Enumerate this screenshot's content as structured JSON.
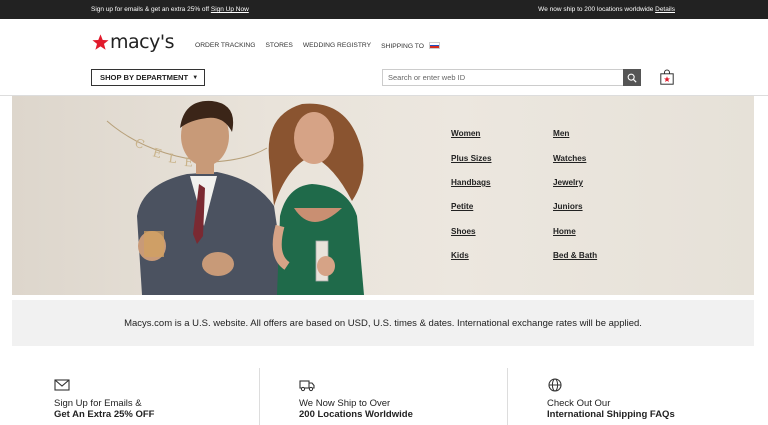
{
  "promo_bar": {
    "left_text": "Sign up for emails & get an extra 25% off",
    "left_link": "Sign Up Now",
    "right_text": "We now ship to 200 locations worldwide",
    "right_link": "Details"
  },
  "header": {
    "logo_text": "macy's",
    "nav": [
      "ORDER TRACKING",
      "STORES",
      "WEDDING REGISTRY",
      "SHIPPING TO"
    ],
    "flag_colors": [
      "#ffffff",
      "#1f4fc1",
      "#d52b1e"
    ],
    "department_button": "SHOP BY DEPARTMENT",
    "search_placeholder": "Search or enter web ID",
    "brand_color": "#e21a2c"
  },
  "hero": {
    "departments_left": [
      "Women",
      "Plus Sizes",
      "Handbags",
      "Petite",
      "Shoes",
      "Kids"
    ],
    "departments_right": [
      "Men",
      "Watches",
      "Jewelry",
      "Juniors",
      "Home",
      "Bed & Bath"
    ]
  },
  "notice": "Macys.com is a U.S. website. All offers are based on USD, U.S. times & dates. International exchange rates will be applied.",
  "info": [
    {
      "icon": "envelope-icon",
      "line1": "Sign Up for Emails &",
      "line2": "Get An Extra 25% OFF"
    },
    {
      "icon": "truck-icon",
      "line1": "We Now Ship to Over",
      "line2": "200 Locations Worldwide"
    },
    {
      "icon": "globe-icon",
      "line1": "Check Out Our",
      "line2": "International Shipping FAQs"
    }
  ]
}
